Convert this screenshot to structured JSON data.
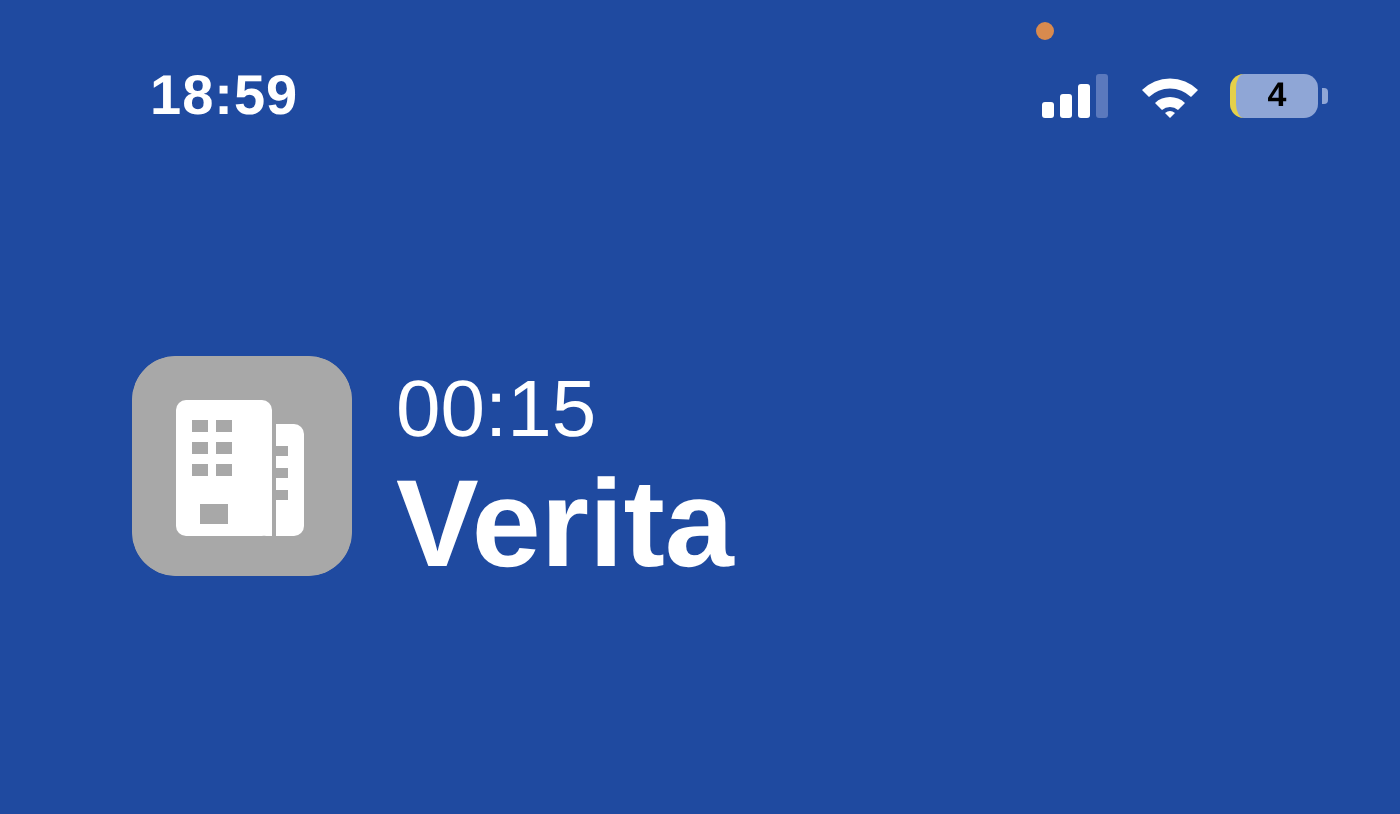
{
  "status_bar": {
    "time": "18:59",
    "battery": "4"
  },
  "activity": {
    "elapsed": "00:15",
    "name": "Verita"
  }
}
